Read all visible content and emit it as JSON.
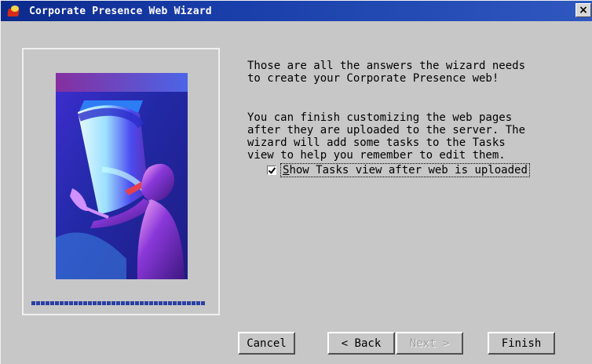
{
  "window": {
    "title": "Corporate Presence Web Wizard",
    "close_symbol": "×",
    "titlebar_color": "#1f46b3",
    "background_color": "#c7c7c7"
  },
  "content": {
    "paragraph_1": "Those are all the answers the wizard needs\nto create your Corporate Presence web!",
    "paragraph_2": "You can finish customizing the web pages\nafter they are uploaded to the server. The\nwizard will add some tasks to the Tasks\nview to help you remember to edit them."
  },
  "options": {
    "show_tasks_label": "Show Tasks view after web is uploaded",
    "show_tasks_checked": true
  },
  "buttons": {
    "cancel": "Cancel",
    "back": "< Back",
    "next": "Next >",
    "finish": "Finish"
  },
  "icons": {
    "app_icon": "wizard-app-icon",
    "close_icon": "close-icon",
    "check_icon": "checkmark-icon"
  },
  "illustration": {
    "subject": "person-writing-on-scroll",
    "primary_colors": [
      "#1d1f9a",
      "#7b2ec9",
      "#9ed8ff",
      "#e63f42"
    ]
  },
  "progress": {
    "value": 1.0
  }
}
